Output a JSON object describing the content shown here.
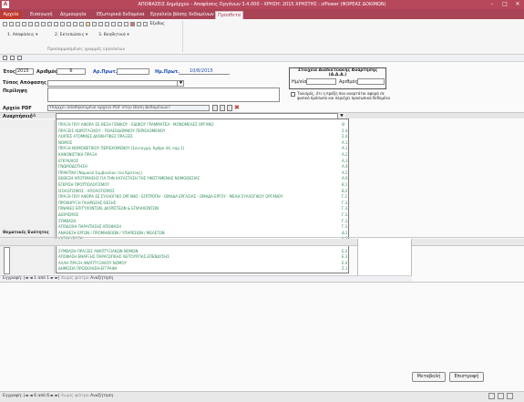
{
  "window": {
    "title": "ΑΠΟΦΑΣΕΙΣ Δημάρχου - Αποφάσεις Οργάνων 3.4.000 - ΧΡΗΣΗ: 2015 ΧΡΗΣΤΗΣ : sfPower (ΦΟΡΕΑΣ ΔΟΚΙΜΩΝ)",
    "app_icon": "Α",
    "minimize": "–",
    "maximize": "□",
    "close": "✕"
  },
  "ribbon": {
    "tabs": [
      "Αρχείο",
      "Εισαγωγή",
      "Δημιουργία",
      "Εξωτερικά δεδομένα",
      "Εργαλεία βάσης δεδομένων",
      "Πρόσθετα"
    ],
    "dropdowns": [
      "1. Αποφάσεις",
      "2. Εκτυπώσεις",
      "3. Βοηθητικά"
    ],
    "exit_label": "Έξοδος",
    "group_label": "Προσαρμοσμένες γραμμές εργαλείων"
  },
  "form": {
    "year_label": "Έτος",
    "year_value": "2015",
    "number_label": "Αριθμός",
    "number_value": "6",
    "protocol_label": "Αρ.Πρωτ.",
    "protocol_date_label": "Ημ.Πρωτ.",
    "protocol_date_value": "10/8/2015",
    "decision_type_label": "Τύπος Απόφασης",
    "summary_label": "Περίληψη",
    "pdf_label": "Αρχείο PDF",
    "pdf_placeholder": "Υπάρχει αποθηκευμένο αρχείο PDF στην Βάση Δεδομένων?",
    "posting_label": "Αναρτήσεις",
    "posting_value": "ΑΔ",
    "diavgeia_title": "Στοιχεία Διαδικτυακής Ανάρτησης (Α.Δ.Α.)",
    "ada_label": "Ημ/νία",
    "ada_number_label": "Αριθμός",
    "checkbox_text": "Τονισμός, ότι η πράξη που αναρτάται αφορά σε φυσικό πρόσωπο και περιέχει προσωπικά δεδομένα",
    "topics_label": "Θεματικές Ενότητες",
    "save_button": "Μεταβολή",
    "back_button": "Επιστροφή"
  },
  "dropdown_list": [
    {
      "name": "ΠΡΑΞΗ ΠΟΥ ΑΦΟΡΑ ΣΕ ΘΕΣΗ ΓΕΝΙΚΟΥ - ΕΙΔΙΚΟΥ ΓΡΑΜΜΑΤΕΑ - ΜΟΝΟΜΕΛΕΣ ΟΡΓΑΝΟ",
      "code": "Θ"
    },
    {
      "name": "ΠΡΑΞΕΙΣ ΧΩΡΟΤΑΞΙΚΟΥ - ΠΟΛΕΟΔΟΜΙΚΟΥ ΠΕΡΙΕΧΟΜΕΝΟΥ",
      "code": "2.4.6.1"
    },
    {
      "name": "ΛΟΙΠΕΣ ΑΤΟΜΙΚΕΣ ΔΙΟΙΚΗΤΙΚΕΣ ΠΡΑΞΕΙΣ",
      "code": "2.4.7.1"
    },
    {
      "name": "ΝΟΜΟΣ",
      "code": "Α.1.1"
    },
    {
      "name": "ΠΡΑΞΗ ΝΟΜΟΘΕΤΙΚΟΥ ΠΕΡΙΕΧΟΜΕΝΟΥ (Σύνταγμα, Άρθρο 44, παρ 1)",
      "code": "Α.1.2"
    },
    {
      "name": "ΚΑΝΟΝΙΣΤΙΚΗ ΠΡΑΞΗ",
      "code": "Α.2"
    },
    {
      "name": "ΕΓΚΥΚΛΙΟΣ",
      "code": "Α.3"
    },
    {
      "name": "ΓΝΩΜΟΔΟΤΗΣΗ",
      "code": "Α.4"
    },
    {
      "name": "ΠΡΑΚΤΙΚΑ (Νομικού Συμβουλίου του Κράτους)",
      "code": "Α.5"
    },
    {
      "name": "ΕΚΘΕΣΗ ΑΠΟΤΙΜΗΣΗΣ ΓΙΑ ΤΗΝ ΚΑΤΑΣΤΑΣΗ ΤΗΣ ΥΦΙΣΤΑΜΕΝΗΣ ΝΟΜΟΘΕΣΙΑΣ",
      "code": "Α.6"
    },
    {
      "name": "ΕΓΚΡΙΣΗ ΠΡΟΫΠΟΛΟΓΙΣΜΟΥ",
      "code": "Β.1.1"
    },
    {
      "name": "ΙΣΟΛΟΓΙΣΜΟΣ - ΑΠΟΛΟΓΙΣΜΟΣ",
      "code": "Β.2"
    },
    {
      "name": "ΠΡΑΞΗ ΠΟΥ ΑΦΟΡΑ ΣΕ ΣΥΛΛΟΓΙΚΟ ΟΡΓΑΝΟ - ΕΠΙΤΡΟΠΗ - ΟΜΑΔΑ ΕΡΓΑΣΙΑΣ - ΟΜΑΔΑ ΕΡΓΟΥ - ΜΕΛΗ ΣΥΛΛΟΓΙΚΟΥ ΟΡΓΑΝΟΥ",
      "code": "Γ.2"
    },
    {
      "name": "ΠΡΟΚΗΡΥΞΗ ΠΛΗΡΩΣΗΣ ΘΕΣΗΣ",
      "code": "Γ.3.1"
    },
    {
      "name": "ΠΙΝΑΚΕΣ ΕΠΙΤΥΧΟΝΤΩΝ, ΔΙΟΡΙΣΤΕΩΝ & ΕΠΙΛΑΧΟΝΤΩΝ",
      "code": "Γ.3.2"
    },
    {
      "name": "ΔΙΟΡΙΣΜΟΣ",
      "code": "Γ.3.3"
    },
    {
      "name": "ΣΥΜΒΑΣΗ",
      "code": "Γ.3.4"
    },
    {
      "name": "ΑΠΟΔΟΧΗ ΠΑΡΑΙΤΗΣΗΣ ΑΠΟΦΑΣΗ",
      "code": "Γ.3.6"
    },
    {
      "name": "ΑΝΑΘΕΣΗ ΕΡΓΩΝ / ΠΡΟΜΗΘΕΙΩΝ / ΥΠΗΡΕΣΙΩΝ / ΜΕΛΕΤΩΝ",
      "code": "Δ.1"
    },
    {
      "name": "ΚΑΤΑΚΥΡΩΣΗ",
      "code": "Δ.2.2"
    },
    {
      "name": "ΠΡΑΞΗ ΥΠΑΓΩΓΗΣ ΕΠΕΝΔΥΣΕΩΝ",
      "code": "Ε.1"
    },
    {
      "name": "ΣΥΜΒΑΣΗ-ΠΡΑΞΕΙΣ ΑΝΑΠΤΥΞΙΑΚΩΝ ΝΟΜΩΝ",
      "code": "Ε.2"
    },
    {
      "name": "ΑΠΟΦΑΣΗ ΕΝΑΡΞΗΣ ΠΑΡΑΓΩΓΙΚΗΣ ΛΕΙΤΟΥΡΓΙΑΣ ΕΠΕΝΔΥΣΗΣ",
      "code": "Ε.3"
    },
    {
      "name": "ΑΛΛΗ ΠΡΑΞΗ ΑΝΑΠΤΥΞΙΑΚΟΥ ΝΟΜΟΥ",
      "code": "Ε.4"
    },
    {
      "name": "ΔΗΜΟΣΙΑ ΠΡΟΣΚΛΗΣΗ-ΕΓΓΡΑΦΑ",
      "code": "Ζ.1"
    }
  ],
  "subnav": {
    "record_label": "Εγγραφή:",
    "record_value": "1 από 1",
    "filter_label": "Χωρίς φίλτρο",
    "search_label": "Αναζήτηση"
  },
  "statusbar": {
    "record_label": "Εγγραφή:",
    "record_value": "6 από 6",
    "filter_label": "Χωρίς φίλτρο",
    "search_label": "Αναζήτηση"
  }
}
